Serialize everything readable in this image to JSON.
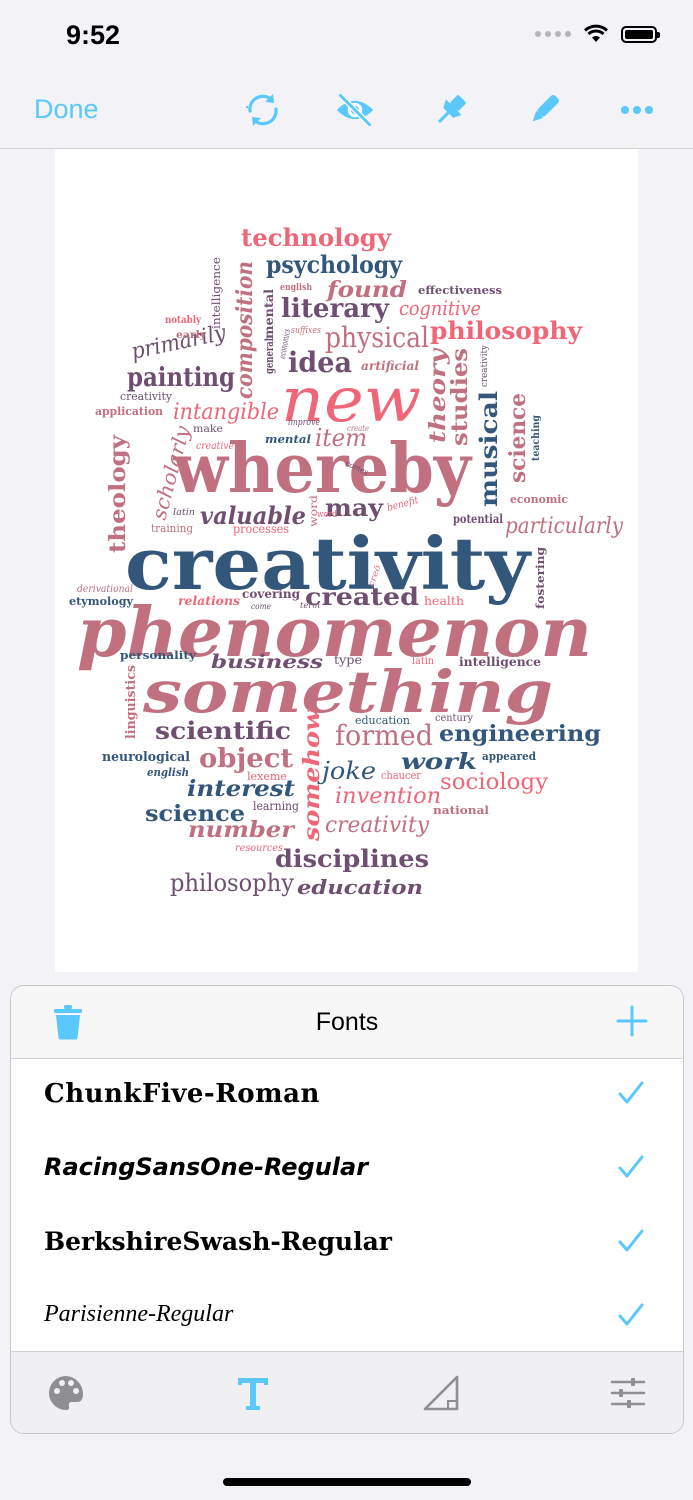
{
  "status_bar": {
    "time": "9:52"
  },
  "toolbar": {
    "done_label": "Done",
    "icons": [
      "refresh-icon",
      "eye-slash-icon",
      "pin-icon",
      "pen-icon",
      "more-icon"
    ],
    "accent": "#5ac8fa"
  },
  "word_cloud": {
    "colors": [
      "#ee6677",
      "#c0707e",
      "#6f4e72",
      "#33577a"
    ],
    "words": [
      "creativity",
      "phenomenon",
      "something",
      "whereby",
      "new",
      "technology",
      "psychology",
      "literary",
      "found",
      "physical",
      "philosophy",
      "cognitive",
      "idea",
      "painting",
      "composition",
      "theory",
      "studies",
      "musical",
      "science",
      "intangible",
      "item",
      "valuable",
      "may",
      "particularly",
      "theology",
      "scholarly",
      "primarily",
      "created",
      "relations",
      "covering",
      "health",
      "business",
      "intelligence",
      "personality",
      "scientific",
      "formed",
      "engineering",
      "object",
      "interest",
      "joke",
      "work",
      "sociology",
      "invention",
      "science",
      "number",
      "creativity",
      "disciplines",
      "philosophy",
      "education",
      "somehow",
      "linguistics",
      "etymology",
      "derivational",
      "neurological",
      "english",
      "lexeme",
      "learning",
      "resources",
      "chaucer",
      "appeared",
      "national",
      "century",
      "latin",
      "type",
      "education",
      "application",
      "creativity",
      "notably",
      "early",
      "intelligence",
      "mental",
      "general",
      "english",
      "effectiveness",
      "suffixes",
      "improve",
      "economics",
      "artificial",
      "creativity",
      "make",
      "creative",
      "mental",
      "create",
      "comes",
      "word",
      "benefit",
      "potential",
      "economic",
      "teaching",
      "fostering",
      "training",
      "processes",
      "latin",
      "term",
      "come",
      "word",
      "creō"
    ]
  },
  "fonts_panel": {
    "title": "Fonts",
    "fonts": [
      {
        "name": "ChunkFive-Roman",
        "checked": true
      },
      {
        "name": "RacingSansOne-Regular",
        "checked": true
      },
      {
        "name": "BerkshireSwash-Regular",
        "checked": true
      },
      {
        "name": "Parisienne-Regular",
        "checked": true
      }
    ],
    "tabs": [
      "palette-icon",
      "text-icon",
      "shape-icon",
      "sliders-icon"
    ],
    "active_tab": "text-icon"
  }
}
